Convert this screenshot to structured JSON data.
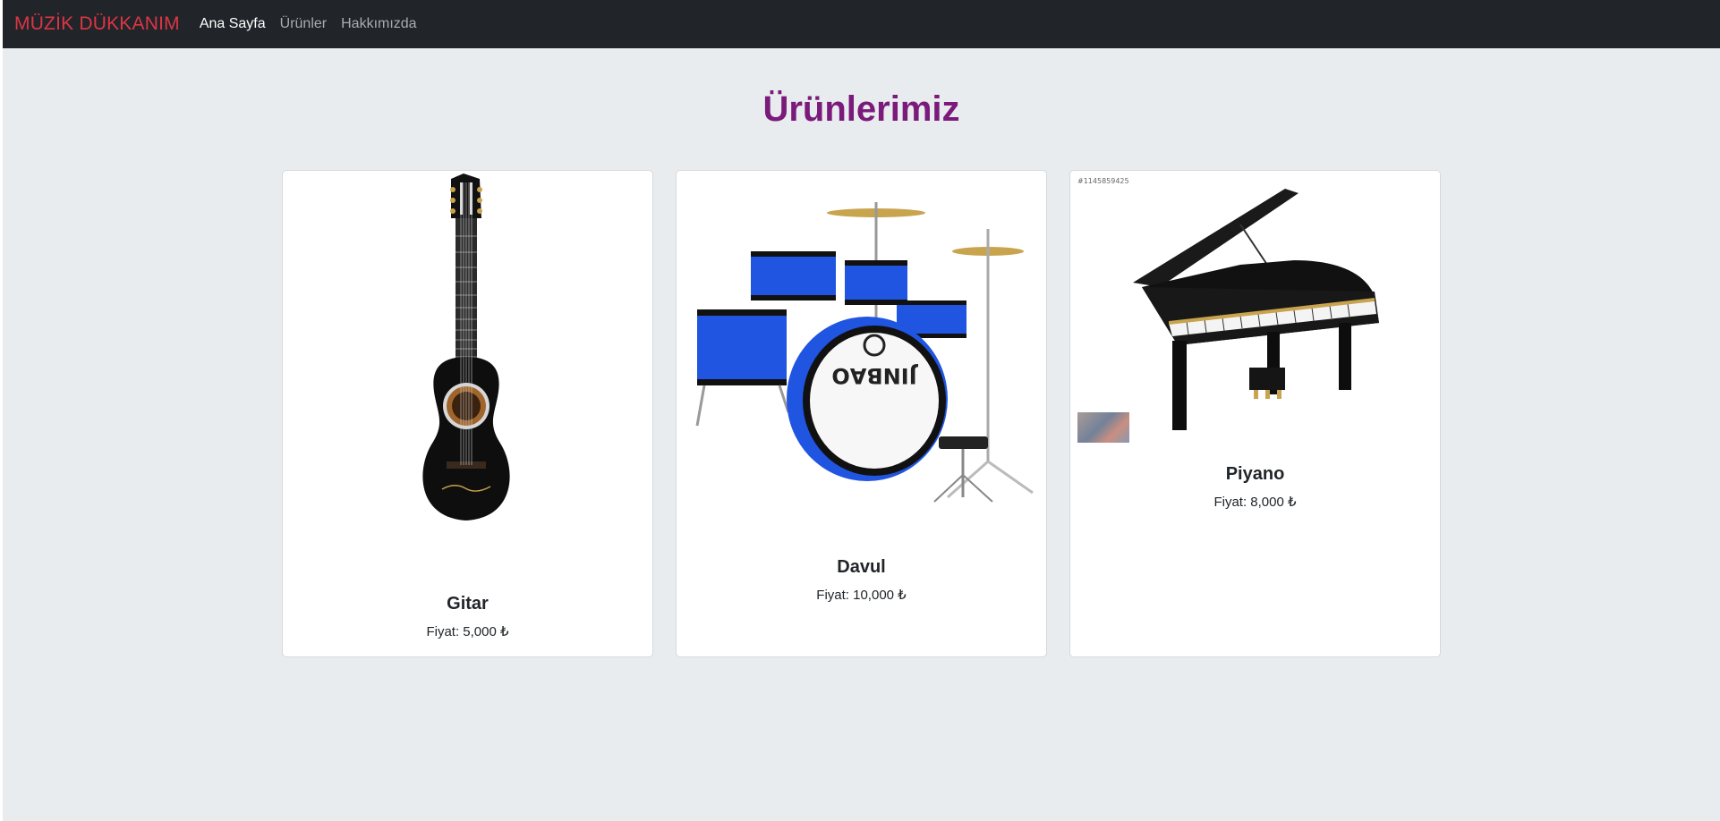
{
  "navbar": {
    "brand": "MÜZİK DÜKKANIM",
    "links": [
      "Ana Sayfa",
      "Ürünler",
      "Hakkımızda"
    ],
    "active_index": 0
  },
  "page": {
    "title": "Ürünlerimiz"
  },
  "products": [
    {
      "name": "Gitar",
      "price": "Fiyat: 5,000 ₺",
      "image_icon": "guitar-image"
    },
    {
      "name": "Davul",
      "price": "Fiyat: 10,000 ₺",
      "image_icon": "drum-kit-image",
      "drum_brand": "JINBAO"
    },
    {
      "name": "Piyano",
      "price": "Fiyat: 8,000 ₺",
      "image_icon": "grand-piano-image",
      "stock_id": "#1145859425"
    }
  ],
  "colors": {
    "brand": "#dc3545",
    "title": "#7a1a7a",
    "navbar_bg": "#212529",
    "page_bg": "#e9ecef",
    "drum_blue": "#1f55e0"
  }
}
